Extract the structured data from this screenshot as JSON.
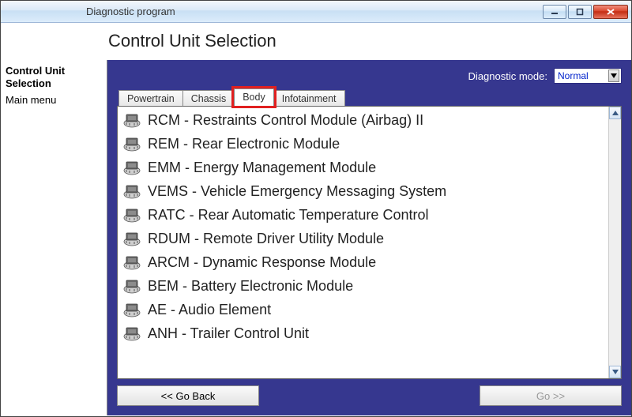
{
  "window": {
    "title": "Diagnostic program"
  },
  "header": {
    "title": "Control Unit Selection"
  },
  "sidebar": {
    "items": [
      {
        "label": "Control Unit Selection",
        "bold": true
      },
      {
        "label": "Main menu",
        "bold": false
      }
    ]
  },
  "diag_mode": {
    "label": "Diagnostic mode:",
    "selected": "Normal"
  },
  "tabs": [
    {
      "label": "Powertrain",
      "active": false,
      "highlighted": false
    },
    {
      "label": "Chassis",
      "active": false,
      "highlighted": false
    },
    {
      "label": "Body",
      "active": true,
      "highlighted": true
    },
    {
      "label": "Infotainment",
      "active": false,
      "highlighted": false
    }
  ],
  "modules": [
    {
      "label": "RCM - Restraints Control Module (Airbag) II"
    },
    {
      "label": "REM - Rear Electronic Module"
    },
    {
      "label": "EMM - Energy Management Module"
    },
    {
      "label": "VEMS - Vehicle Emergency Messaging System"
    },
    {
      "label": "RATC - Rear Automatic Temperature Control"
    },
    {
      "label": "RDUM - Remote Driver Utility Module"
    },
    {
      "label": "ARCM - Dynamic Response Module"
    },
    {
      "label": "BEM - Battery Electronic Module"
    },
    {
      "label": "AE - Audio Element"
    },
    {
      "label": "ANH - Trailer Control Unit"
    }
  ],
  "footer": {
    "back": "<< Go Back",
    "go": "Go >>"
  }
}
